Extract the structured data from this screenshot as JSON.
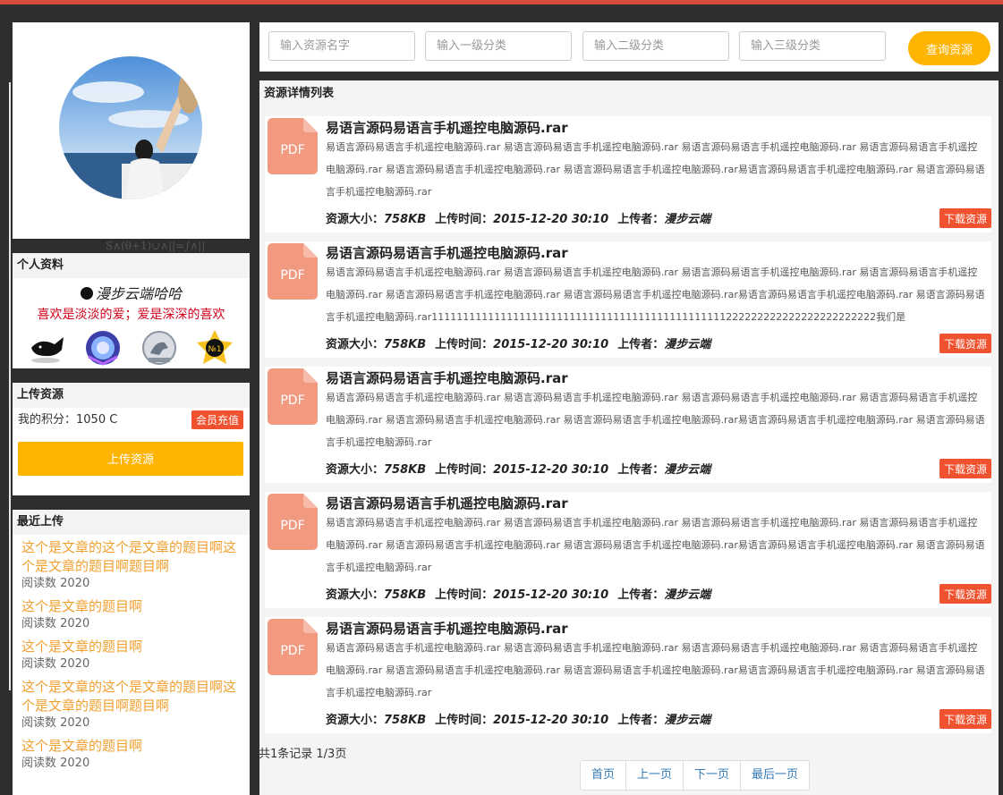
{
  "colors": {
    "accent_yellow": "#ffb400",
    "accent_red": "#f0522f",
    "link_orange": "#f0a030",
    "motto_red": "#d0021b",
    "top_stripe": "#d84a3c"
  },
  "profile": {
    "section_title": "个人资料",
    "nickname": "漫步云端哈哈",
    "motto": "喜欢是淡淡的爱；爱是深深的喜欢",
    "badges": [
      "whale-badge",
      "crest-badge",
      "rider-badge",
      "no1-badge"
    ]
  },
  "upload": {
    "section_title": "上传资源",
    "points_label": "我的积分：1050 C",
    "recharge_label": "会员充值",
    "upload_button": "上传资源"
  },
  "recent": {
    "section_title": "最近上传",
    "items": [
      {
        "title": "这个是文章的这个是文章的题目啊这个是文章的题目啊题目啊",
        "reads": "阅读数  2020"
      },
      {
        "title": "这个是文章的题目啊",
        "reads": "阅读数  2020"
      },
      {
        "title": "这个是文章的题目啊",
        "reads": "阅读数  2020"
      },
      {
        "title": "这个是文章的这个是文章的题目啊这个是文章的题目啊题目啊",
        "reads": "阅读数  2020"
      },
      {
        "title": "这个是文章的题目啊",
        "reads": "阅读数  2020"
      }
    ]
  },
  "search": {
    "placeholders": [
      "输入资源名字",
      "输入一级分类",
      "输入二级分类",
      "输入三级分类"
    ],
    "button": "查询资源"
  },
  "list": {
    "title": "资源详情列表",
    "icon_label": "PDF",
    "size_label": "资源大小：",
    "time_label": "上传时间：",
    "uploader_label": "上传者：",
    "download_label": "下载资源",
    "items": [
      {
        "title": "易语言源码易语言手机遥控电脑源码.rar",
        "desc": "易语言源码易语言手机遥控电脑源码.rar 易语言源码易语言手机遥控电脑源码.rar 易语言源码易语言手机遥控电脑源码.rar 易语言源码易语言手机遥控电脑源码.rar 易语言源码易语言手机遥控电脑源码.rar 易语言源码易语言手机遥控电脑源码.rar易语言源码易语言手机遥控电脑源码.rar 易语言源码易语言手机遥控电脑源码.rar",
        "size": "758KB",
        "time": "2015-12-20 30:10",
        "uploader": "漫步云端"
      },
      {
        "title": "易语言源码易语言手机遥控电脑源码.rar",
        "desc": "易语言源码易语言手机遥控电脑源码.rar 易语言源码易语言手机遥控电脑源码.rar 易语言源码易语言手机遥控电脑源码.rar 易语言源码易语言手机遥控电脑源码.rar 易语言源码易语言手机遥控电脑源码.rar 易语言源码易语言手机遥控电脑源码.rar易语言源码易语言手机遥控电脑源码.rar 易语言源码易语言手机遥控电脑源码.rar11111111111111111111111111111111111111111111111222222222222222222222222我们是",
        "size": "758KB",
        "time": "2015-12-20 30:10",
        "uploader": "漫步云端"
      },
      {
        "title": "易语言源码易语言手机遥控电脑源码.rar",
        "desc": "易语言源码易语言手机遥控电脑源码.rar 易语言源码易语言手机遥控电脑源码.rar 易语言源码易语言手机遥控电脑源码.rar 易语言源码易语言手机遥控电脑源码.rar 易语言源码易语言手机遥控电脑源码.rar 易语言源码易语言手机遥控电脑源码.rar易语言源码易语言手机遥控电脑源码.rar 易语言源码易语言手机遥控电脑源码.rar",
        "size": "758KB",
        "time": "2015-12-20 30:10",
        "uploader": "漫步云端"
      },
      {
        "title": "易语言源码易语言手机遥控电脑源码.rar",
        "desc": "易语言源码易语言手机遥控电脑源码.rar 易语言源码易语言手机遥控电脑源码.rar 易语言源码易语言手机遥控电脑源码.rar 易语言源码易语言手机遥控电脑源码.rar 易语言源码易语言手机遥控电脑源码.rar 易语言源码易语言手机遥控电脑源码.rar易语言源码易语言手机遥控电脑源码.rar 易语言源码易语言手机遥控电脑源码.rar",
        "size": "758KB",
        "time": "2015-12-20 30:10",
        "uploader": "漫步云端"
      },
      {
        "title": "易语言源码易语言手机遥控电脑源码.rar",
        "desc": "易语言源码易语言手机遥控电脑源码.rar 易语言源码易语言手机遥控电脑源码.rar 易语言源码易语言手机遥控电脑源码.rar 易语言源码易语言手机遥控电脑源码.rar 易语言源码易语言手机遥控电脑源码.rar 易语言源码易语言手机遥控电脑源码.rar易语言源码易语言手机遥控电脑源码.rar 易语言源码易语言手机遥控电脑源码.rar",
        "size": "758KB",
        "time": "2015-12-20 30:10",
        "uploader": "漫步云端"
      }
    ]
  },
  "pagination": {
    "summary": "共1条记录 1/3页",
    "first": "首页",
    "prev": "上一页",
    "next": "下一页",
    "last": "最后一页"
  }
}
